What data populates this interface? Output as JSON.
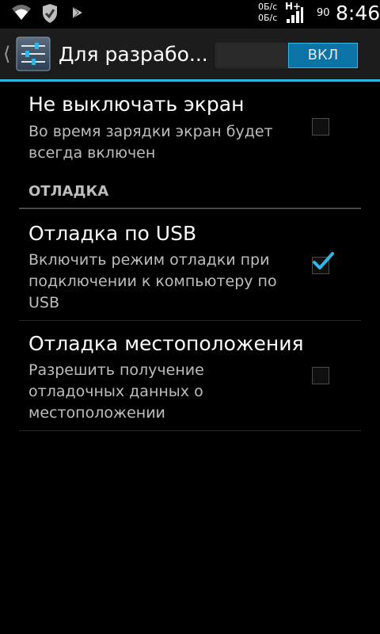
{
  "status_bar": {
    "icons": [
      "wifi-icon",
      "shield-icon",
      "play-store-icon",
      "signal-icon"
    ],
    "rate_up": "0Б/с",
    "rate_down": "0Б/с",
    "network_type": "H+",
    "battery": "90",
    "time": "8:46"
  },
  "action_bar": {
    "title": "Для разрабо...",
    "switch_label": "ВКЛ",
    "switch_on": true,
    "accent_color": "#33b5e5"
  },
  "preferences": [
    {
      "title": "Не выключать экран",
      "summary": "Во время зарядки экран будет всегда включен",
      "checked": false
    }
  ],
  "category": {
    "title": "ОТЛАДКА",
    "items": [
      {
        "title": "Отладка по USB",
        "summary": "Включить режим отладки при подключении к компьютеру по USB",
        "checked": true
      },
      {
        "title": "Отладка местоположения",
        "summary": "Разрешить получение отладочных данных о местоположении",
        "checked": false
      }
    ]
  }
}
